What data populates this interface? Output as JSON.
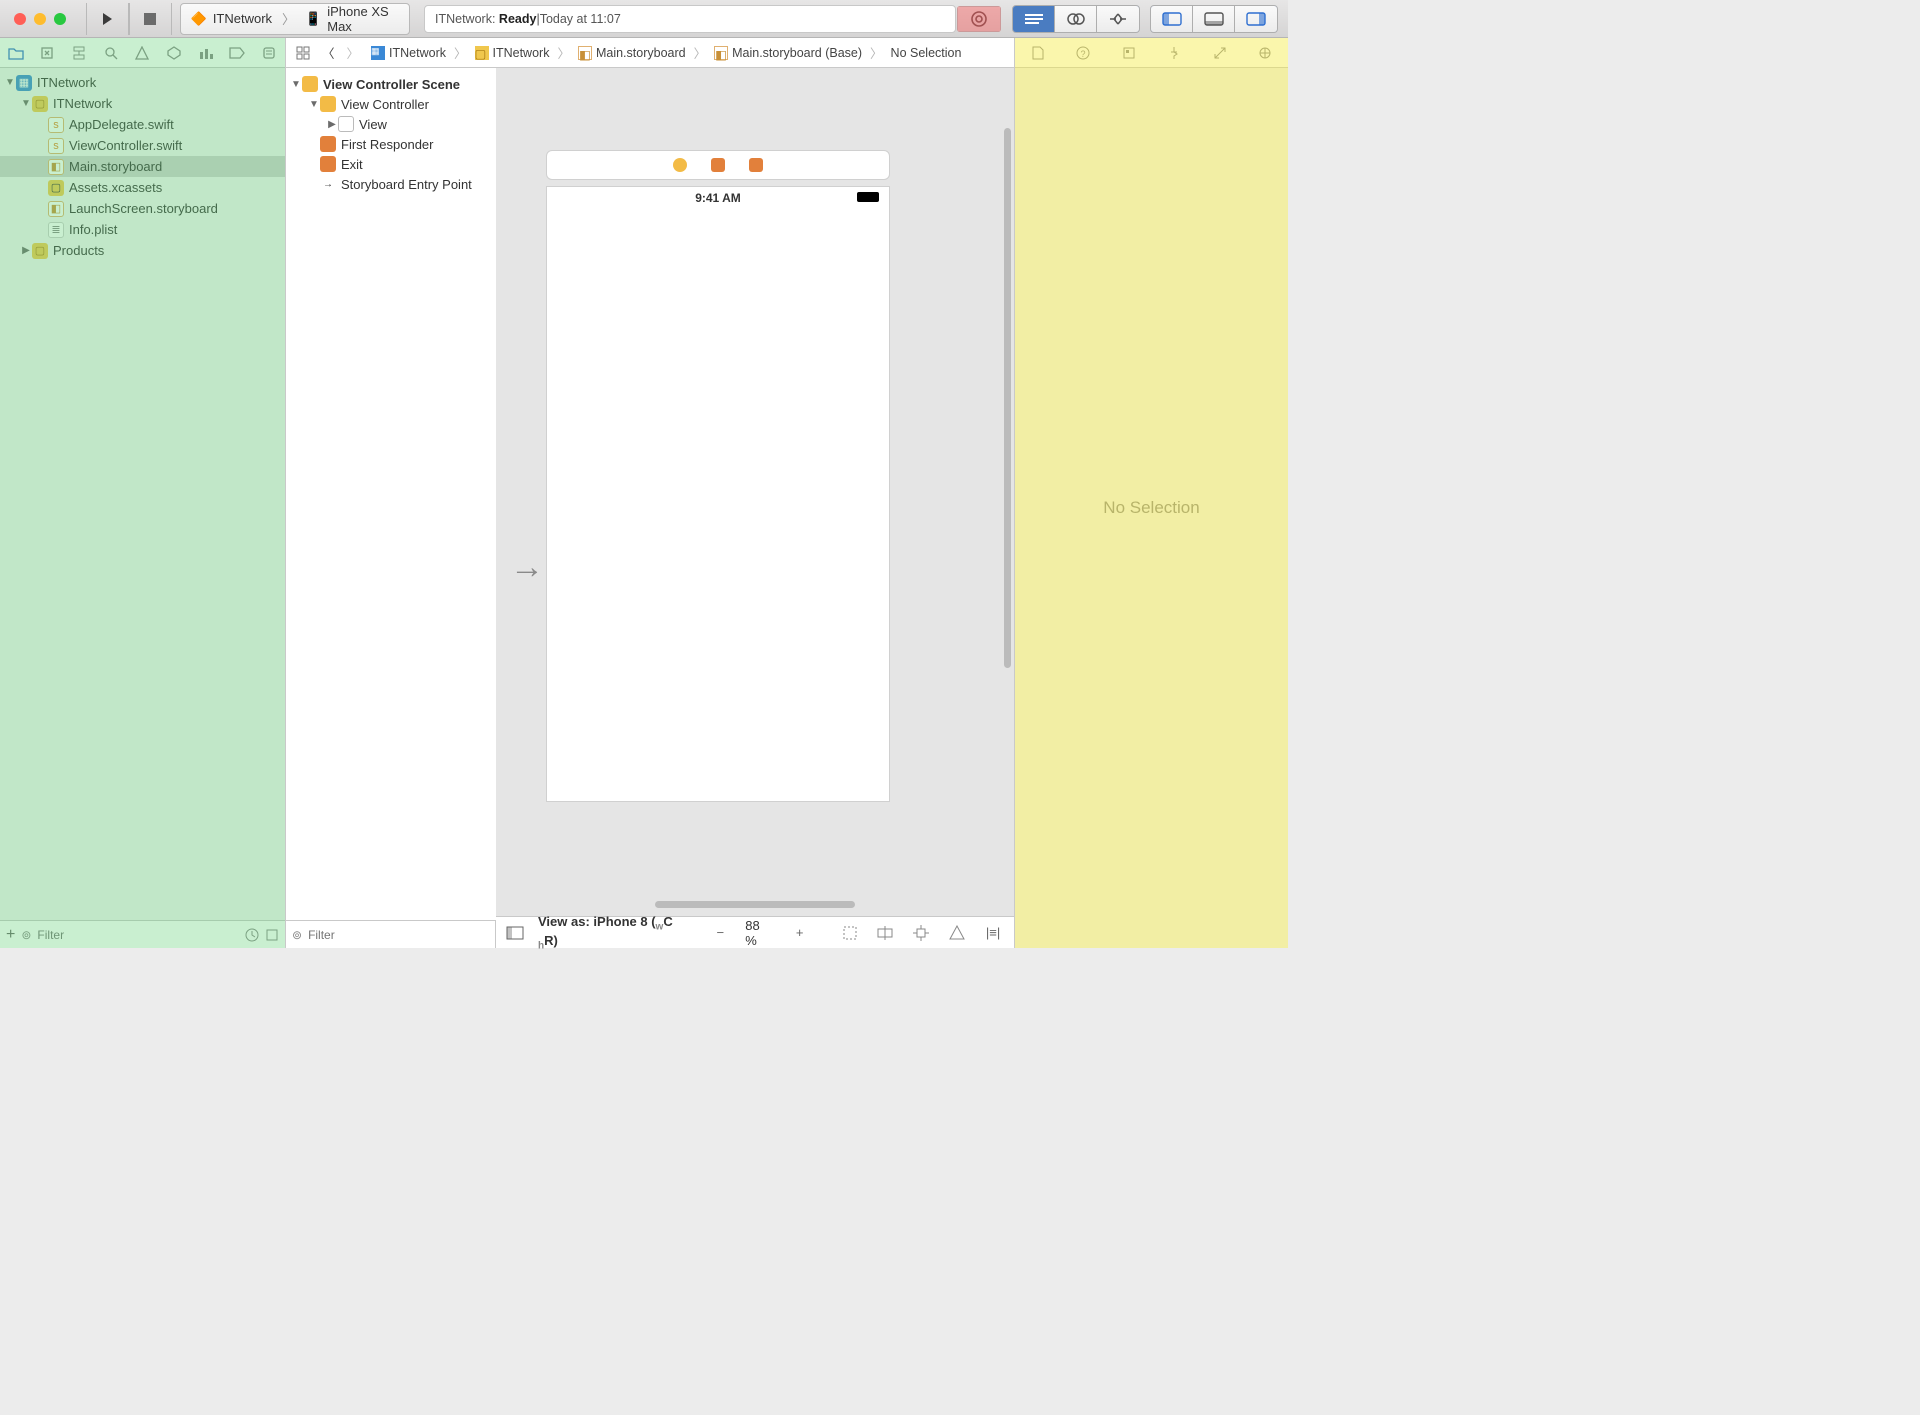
{
  "toolbar": {
    "scheme_project": "ITNetwork",
    "scheme_device": "iPhone XS Max",
    "activity_project": "ITNetwork:",
    "activity_status": "Ready",
    "activity_sep": " | ",
    "activity_time": "Today at 11:07"
  },
  "nav_filter_placeholder": "Filter",
  "outline_filter_placeholder": "Filter",
  "project_tree": {
    "root": "ITNetwork",
    "group": "ITNetwork",
    "files": [
      "AppDelegate.swift",
      "ViewController.swift",
      "Main.storyboard",
      "Assets.xcassets",
      "LaunchScreen.storyboard",
      "Info.plist"
    ],
    "products": "Products",
    "selected_index": 2
  },
  "jumpbar": {
    "items": [
      "ITNetwork",
      "ITNetwork",
      "Main.storyboard",
      "Main.storyboard (Base)",
      "No Selection"
    ]
  },
  "outline": {
    "scene": "View Controller Scene",
    "vc": "View Controller",
    "view": "View",
    "first": "First Responder",
    "exit": "Exit",
    "entry": "Storyboard Entry Point"
  },
  "device_time": "9:41 AM",
  "canvas_bottom": {
    "view_as_prefix": "View as: ",
    "device": "iPhone 8",
    "trait_w": "w",
    "trait_c": "C ",
    "trait_h": "h",
    "trait_r": "R",
    "zoom": "88 %"
  },
  "inspector_empty": "No Selection"
}
